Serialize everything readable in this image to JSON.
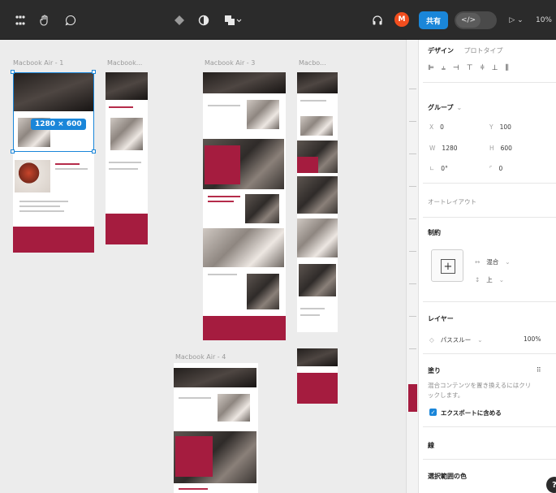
{
  "toolbar": {
    "zoom": "10%",
    "share_label": "共有",
    "code_label": "</>",
    "avatar_initial": "M",
    "play_label": "▷ ⌄"
  },
  "canvas": {
    "frames": [
      {
        "label": "Macbook Air - 1"
      },
      {
        "label": "Macbook..."
      },
      {
        "label": "Macbook Air - 3"
      },
      {
        "label": "Macbo..."
      },
      {
        "label": "Macbook Air - 4"
      }
    ],
    "selection_size": "1280 × 600"
  },
  "panel": {
    "tabs": [
      {
        "label": "デザイン",
        "active": true
      },
      {
        "label": "プロトタイプ",
        "active": false
      }
    ],
    "group": {
      "title": "グループ",
      "x_label": "X",
      "x_value": "0",
      "y_label": "Y",
      "y_value": "100",
      "w_label": "W",
      "w_value": "1280",
      "h_label": "H",
      "h_value": "600",
      "rotation_value": "0°",
      "radius_value": "0"
    },
    "auto_layout": "オートレイアウト",
    "constraints": {
      "title": "制約",
      "horizontal": "混合",
      "vertical": "上"
    },
    "layer": {
      "title": "レイヤー",
      "blend": "パススルー",
      "opacity": "100%"
    },
    "fill": {
      "title": "塗り",
      "note_line1": "混合コンテンツを置き換えるにはクリ",
      "note_line2": "ックします。",
      "export_label": "エクスポートに含める"
    },
    "stroke_section": "線",
    "selection_colors": "選択範囲の色",
    "help_label": "?"
  },
  "colors": {
    "accent": "#1a86d9",
    "brand_crimson": "#a51c3f",
    "toolbar_bg": "#2b2b2b"
  }
}
